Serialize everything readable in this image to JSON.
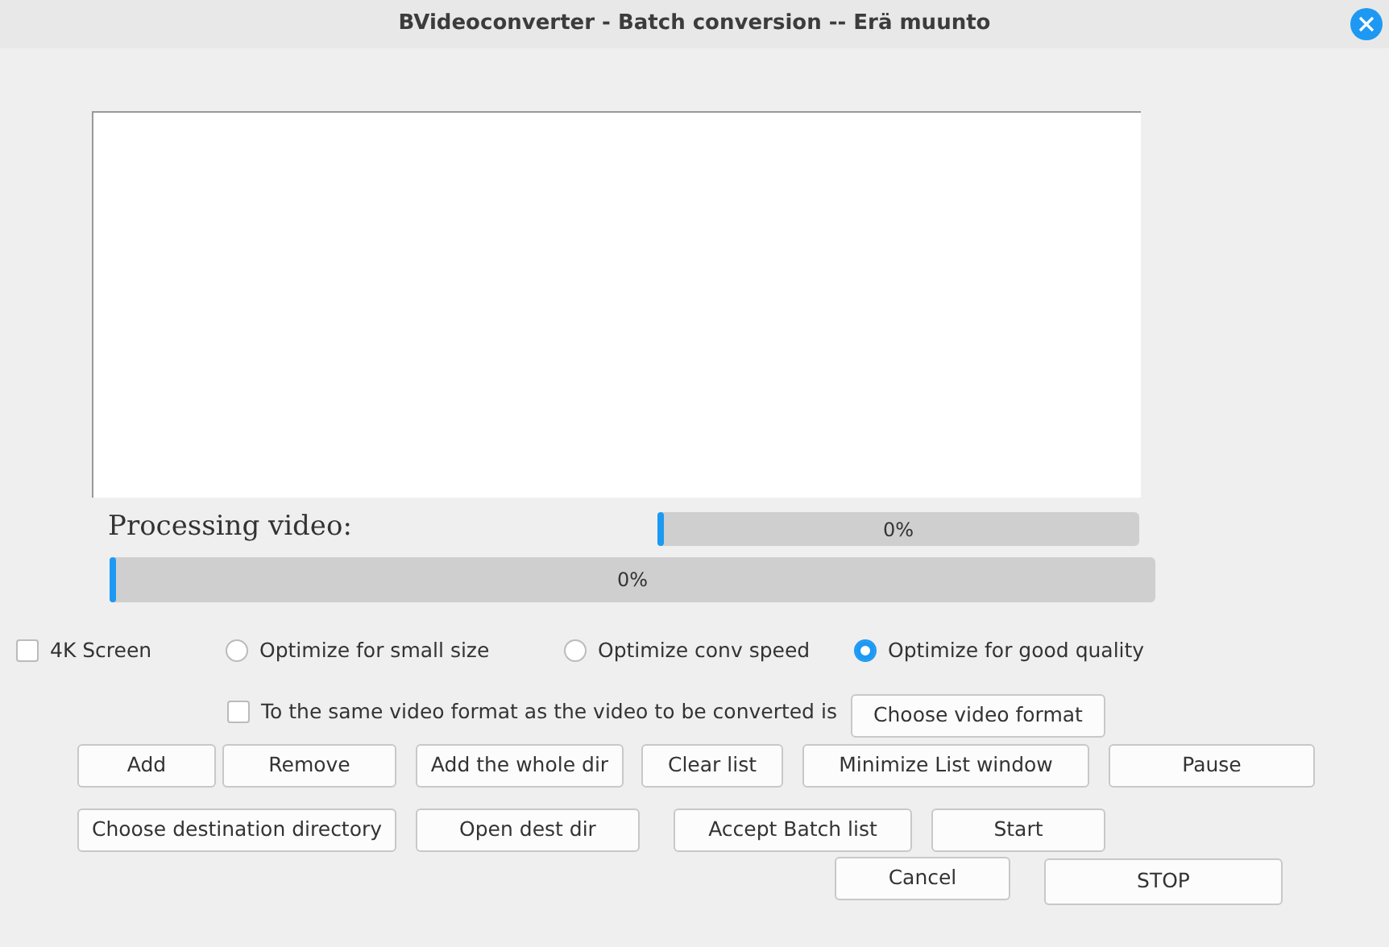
{
  "window": {
    "title": "BVideoconverter - Batch conversion -- Erä muunto"
  },
  "processing_label": "Processing video:",
  "progress": [
    {
      "level": 0,
      "reading": "0%"
    },
    {
      "level": 0,
      "reading": "0%"
    }
  ],
  "options": [
    {
      "kind": "checkbox",
      "label": "4K Screen",
      "checked": false
    },
    {
      "kind": "radio",
      "label": "Optimize for small size",
      "selected": false
    },
    {
      "kind": "radio",
      "label": "Optimize conv speed",
      "selected": false
    },
    {
      "kind": "radio",
      "label": "Optimize for good quality",
      "selected": true
    }
  ],
  "same_format": {
    "label": "To the same video format as the video to be converted is",
    "checked": false
  },
  "button_rows": [
    [
      "Choose video format"
    ],
    [
      "Add",
      "Remove",
      "Add the whole dir",
      "Clear list",
      "Minimize List window",
      "Pause"
    ],
    [
      "Choose destination directory",
      "Open dest dir",
      "Accept Batch list",
      "Start"
    ],
    [
      "Cancel",
      "STOP"
    ]
  ]
}
